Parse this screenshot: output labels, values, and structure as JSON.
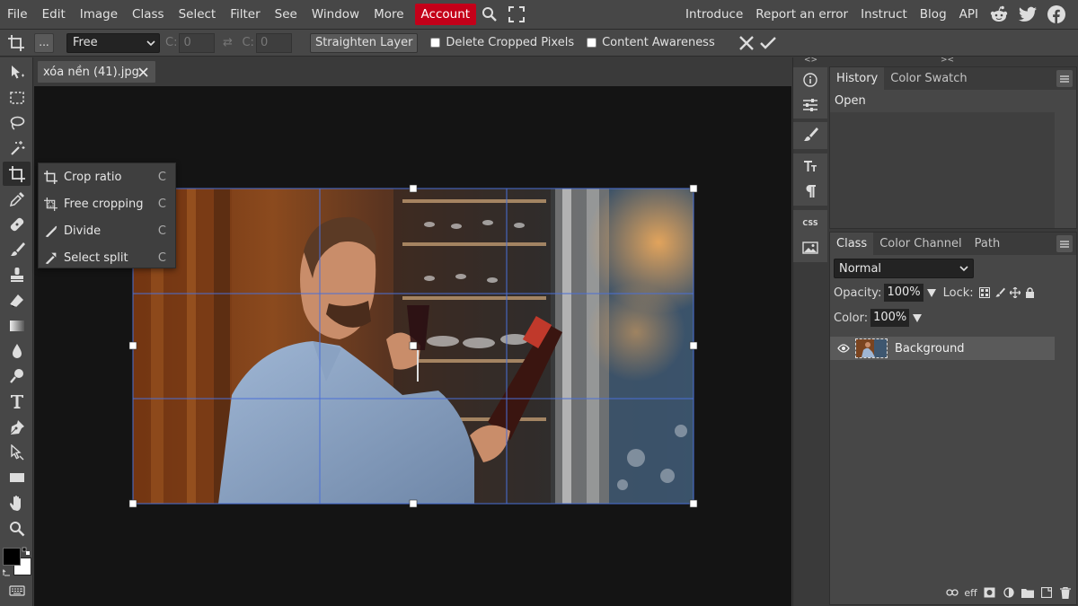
{
  "menubar": {
    "items": [
      "File",
      "Edit",
      "Image",
      "Class",
      "Select",
      "Filter",
      "See",
      "Window",
      "More"
    ],
    "account_label": "Account",
    "right_links": [
      "Introduce",
      "Report an error",
      "Instruct",
      "Blog",
      "API"
    ]
  },
  "options": {
    "more_label": "...",
    "ratio_value": "Free",
    "width_label": "C:",
    "width_value": "0",
    "height_label": "C:",
    "height_value": "0",
    "swap_symbol": "⇄",
    "straighten_label": "Straighten Layer",
    "delete_cropped_label": "Delete Cropped Pixels",
    "content_awareness_label": "Content Awareness"
  },
  "document": {
    "tab_title": "xóa nền (41).jpg"
  },
  "crop_menu": {
    "items": [
      {
        "label": "Crop ratio",
        "key": "C"
      },
      {
        "label": "Free cropping",
        "key": "C"
      },
      {
        "label": "Divide",
        "key": "C"
      },
      {
        "label": "Select split",
        "key": "C"
      }
    ]
  },
  "history_panel": {
    "tabs": [
      "History",
      "Color Swatch"
    ],
    "rows": [
      "Open"
    ]
  },
  "layers_panel": {
    "tabs": [
      "Class",
      "Color Channel",
      "Path"
    ],
    "blend_mode": "Normal",
    "opacity_label": "Opacity:",
    "opacity_value": "100%",
    "lock_label": "Lock:",
    "fill_label": "Color:",
    "fill_value": "100%",
    "layers": [
      {
        "name": "Background",
        "visible": true
      }
    ],
    "footer_fx_label": "eff"
  },
  "strip_arrows": {
    "left": "<>",
    "right": "><"
  },
  "colors": {
    "accent": "#c40019",
    "chrome": "#474747",
    "canvas_bg": "#141414",
    "crop_guide": "#4a6fd6"
  }
}
